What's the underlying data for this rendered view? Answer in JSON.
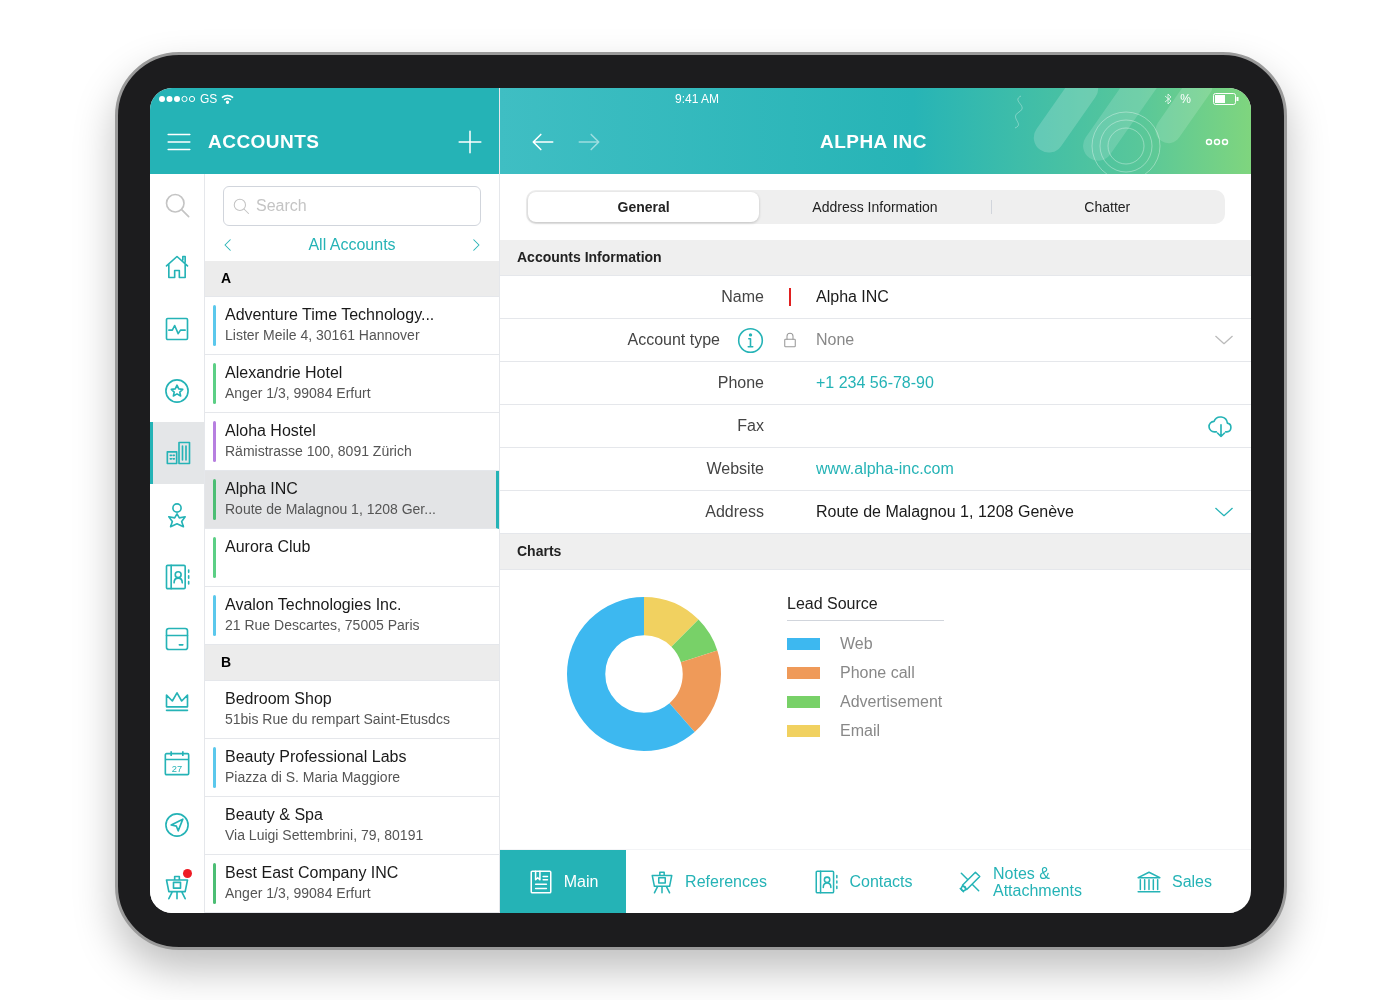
{
  "status_bar": {
    "carrier": "GS",
    "time": "9:41 AM",
    "battery_text": "%"
  },
  "left_header": {
    "title": "ACCOUNTS"
  },
  "search": {
    "placeholder": "Search"
  },
  "list_nav": {
    "title": "All Accounts"
  },
  "rail": [
    {
      "kind": "search",
      "selected": false
    },
    {
      "kind": "home",
      "selected": false
    },
    {
      "kind": "pulse",
      "selected": false
    },
    {
      "kind": "star",
      "selected": false
    },
    {
      "kind": "buildings",
      "selected": true
    },
    {
      "kind": "person",
      "selected": false
    },
    {
      "kind": "contacts",
      "selected": false
    },
    {
      "kind": "box",
      "selected": false
    },
    {
      "kind": "crown",
      "selected": false
    },
    {
      "kind": "calendar",
      "day": "27",
      "selected": false
    },
    {
      "kind": "send",
      "selected": false
    },
    {
      "kind": "easel",
      "selected": false,
      "notification": true
    }
  ],
  "sections": [
    {
      "letter": "A",
      "accounts": [
        {
          "name": "Adventure Time Technology...",
          "address": "Lister Meile 4, 30161 Hannover",
          "color": "#5bc8ec",
          "selected": false
        },
        {
          "name": "Alexandrie Hotel",
          "address": "Anger 1/3, 99084 Erfurt",
          "color": "#5ccf85",
          "selected": false
        },
        {
          "name": "Aloha Hostel",
          "address": "Rämistrasse 100, 8091 Zürich",
          "color": "#b77fe0",
          "selected": false
        },
        {
          "name": "Alpha INC",
          "address": "Route de Malagnou 1, 1208 Ger...",
          "color": "#4cbe74",
          "selected": true
        },
        {
          "name": "Aurora Club",
          "color": "#5ccf85",
          "selected": false
        },
        {
          "name": "Avalon Technologies Inc.",
          "address": "21 Rue Descartes, 75005 Paris",
          "color": "#5bc8ec",
          "selected": false
        }
      ]
    },
    {
      "letter": "B",
      "accounts": [
        {
          "name": "Bedroom Shop",
          "address": "51bis Rue du rempart Saint-Etusdcs",
          "selected": false
        },
        {
          "name": "Beauty Professional Labs",
          "address": "Piazza di S. Maria Maggiore",
          "color": "#5bc8ec",
          "selected": false
        },
        {
          "name": "Beauty & Spa",
          "address": "Via Luigi Settembrini, 79, 80191",
          "selected": false
        },
        {
          "name": "Best East Company INC",
          "address": "Anger 1/3, 99084 Erfurt",
          "color": "#4cbe74",
          "selected": false
        }
      ]
    }
  ],
  "right_header": {
    "title": "ALPHA INC"
  },
  "tabs": [
    {
      "label": "General",
      "selected": true
    },
    {
      "label": "Address Information",
      "selected": false
    },
    {
      "label": "Chatter",
      "selected": false
    }
  ],
  "info_section": {
    "title": "Accounts Information",
    "fields": [
      {
        "kind": "required",
        "label": "Name",
        "value": "Alpha INC"
      },
      {
        "kind": "picklist",
        "label": "Account type",
        "value": "None",
        "locked": true
      },
      {
        "kind": "link",
        "label": "Phone",
        "value": "+1 234 56-78-90"
      },
      {
        "kind": "download",
        "label": "Fax"
      },
      {
        "kind": "link",
        "label": "Website",
        "value": "www.alpha-inc.com"
      },
      {
        "kind": "expand",
        "label": "Address",
        "value": "Route de Malagnou 1, 1208 Genève"
      }
    ]
  },
  "charts_section": {
    "title": "Charts",
    "legend_title": "Lead Source",
    "legend": [
      {
        "label": "Web",
        "color": "#3db8f0"
      },
      {
        "label": "Phone call",
        "color": "#ef9a59"
      },
      {
        "label": "Advertisement",
        "color": "#78d168"
      },
      {
        "label": "Email",
        "color": "#f1d160"
      }
    ]
  },
  "bottom_tabs": [
    {
      "kind": "doc",
      "label": "Main",
      "selected": true
    },
    {
      "kind": "easel",
      "label": "References",
      "selected": false
    },
    {
      "kind": "contacts",
      "label": "Contacts",
      "selected": false
    },
    {
      "kind": "clip",
      "label": "Notes & Attachments",
      "selected": false
    },
    {
      "kind": "bank",
      "label": "Sales",
      "selected": false
    }
  ]
}
